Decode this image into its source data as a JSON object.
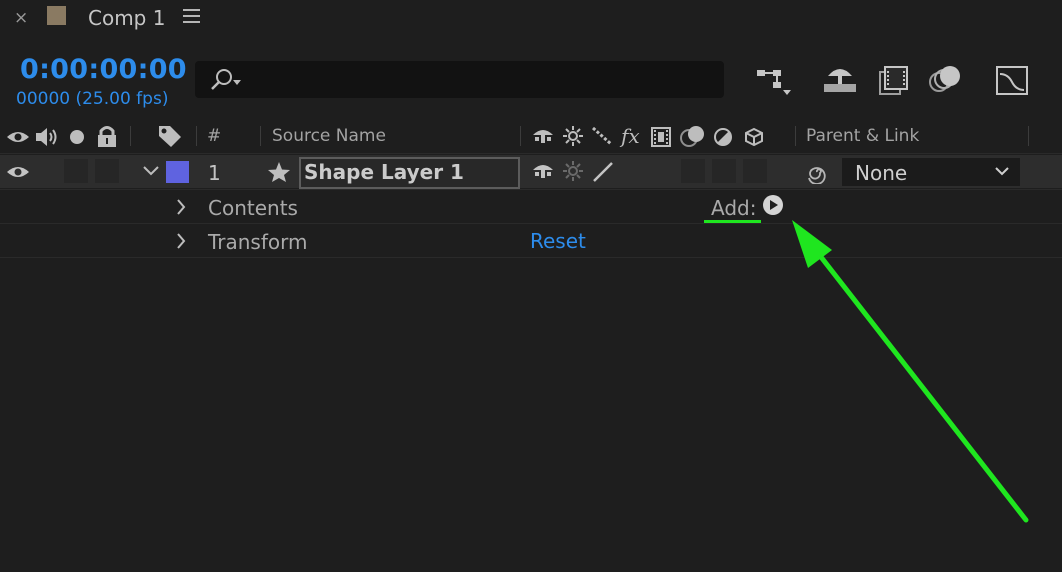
{
  "tab": {
    "close_glyph": "×",
    "title": "Comp 1",
    "swatch_color": "#8a7a62"
  },
  "time": {
    "timecode": "0:00:00:00",
    "frames": "00000 (25.00 fps)"
  },
  "search": {
    "placeholder": "",
    "icon": "search-icon"
  },
  "toolbar": {
    "icons": [
      "composition-flowchart-icon",
      "draft-3d-icon",
      "frame-blending-icon",
      "motion-blur-icon",
      "graph-editor-icon"
    ]
  },
  "columns": {
    "number": "#",
    "source_name": "Source Name",
    "parent_link": "Parent & Link",
    "left_icons": [
      "eye-icon",
      "audio-icon",
      "solo-icon",
      "lock-icon",
      "label-tag-icon"
    ],
    "switch_icons": [
      "shy-icon",
      "collapse-icon",
      "quality-icon",
      "fx-icon",
      "frame-blend-icon",
      "motion-blur-icon",
      "adjustment-layer-icon",
      "3d-layer-icon"
    ]
  },
  "layer": {
    "number": "1",
    "name": "Shape Layer 1",
    "label_color": "#5f63e0",
    "parent": "None"
  },
  "properties": {
    "contents_label": "Contents",
    "transform_label": "Transform",
    "reset_label": "Reset",
    "add_label": "Add:"
  },
  "annotation": {
    "color": "#1fe61f"
  }
}
